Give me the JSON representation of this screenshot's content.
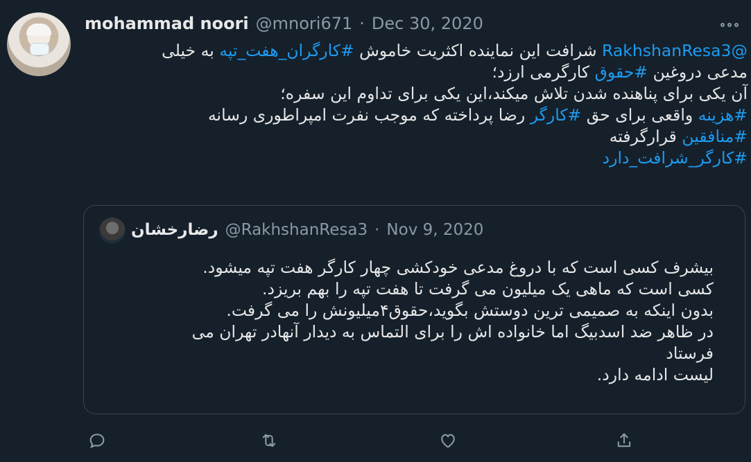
{
  "tweet": {
    "author_name": "mohammad noori",
    "author_handle": "@mnori671",
    "separator": "·",
    "date": "Dec 30, 2020",
    "body_lines": [
      [
        {
          "text": "@RakhshanResa3",
          "tag": true
        },
        {
          "text": " شرافت این نماینده اکثریت خاموش ",
          "tag": false
        },
        {
          "text": "#کارگران_هفت_تپه",
          "tag": true
        },
        {
          "text": " به خیلی",
          "tag": false
        }
      ],
      [
        {
          "text": "مدعی دروغین ",
          "tag": false
        },
        {
          "text": "#حقوق",
          "tag": true
        },
        {
          "text": " کارگرمی ارزد؛",
          "tag": false
        }
      ],
      [
        {
          "text": "آن یکی برای پناهنده شدن تلاش میکند،این یکی برای تداوم این سفره؛",
          "tag": false
        }
      ],
      [
        {
          "text": "#هزینه",
          "tag": true
        },
        {
          "text": " واقعی برای حق ",
          "tag": false
        },
        {
          "text": "#کارگر",
          "tag": true
        },
        {
          "text": " رضا پرداخته که موجب نفرت امپراطوری رسانه",
          "tag": false
        }
      ],
      [
        {
          "text": "#منافقین",
          "tag": true
        },
        {
          "text": " قرارگرفته",
          "tag": false
        }
      ],
      [
        {
          "text": "#کارگر_شرافت_دارد",
          "tag": true
        }
      ]
    ]
  },
  "quoted": {
    "author_name": "رضارخشان",
    "author_handle": "@RakhshanResa3",
    "separator": "·",
    "date": "Nov 9, 2020",
    "body_lines": [
      "بیشرف کسی است که با دروغ مدعی خودکشی چهار کارگر هفت تپه میشود.",
      "کسی است که ماهی یک میلیون می گرفت تا هفت تپه را بهم بریزد.",
      "بدون اینکه به صمیمی ترین دوستش بگوید،حقوق۴میلیونش را می گرفت.",
      "در ظاهر ضد اسدبیگ اما خانواده اش را برای التماس به دیدار آنهادر تهران می",
      "فرستاد",
      "لیست ادامه دارد."
    ]
  },
  "actions": [
    {
      "name": "reply-icon"
    },
    {
      "name": "retweet-icon"
    },
    {
      "name": "like-icon"
    },
    {
      "name": "share-icon"
    }
  ],
  "colors": {
    "background": "#15202b",
    "link": "#1d9bf0",
    "muted": "#8b98a5",
    "border": "#38444d"
  }
}
